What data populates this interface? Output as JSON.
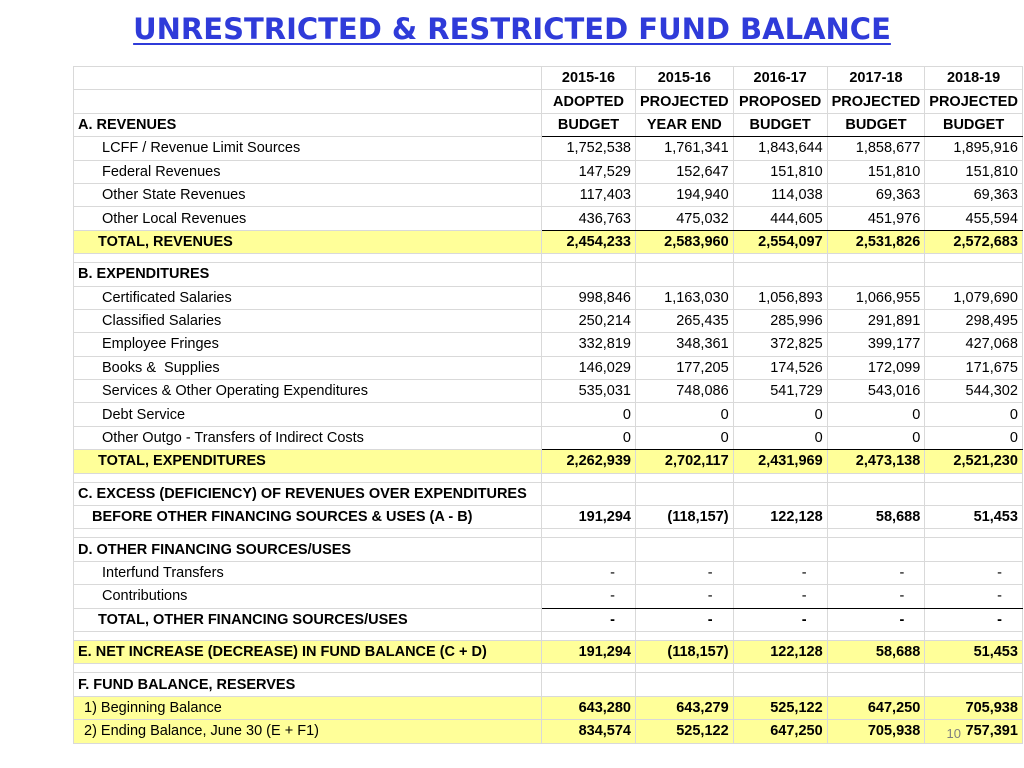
{
  "title": "UNRESTRICTED & RESTRICTED FUND BALANCE",
  "page_number": "10",
  "headers": {
    "row1": [
      "2015-16",
      "2015-16",
      "2016-17",
      "2017-18",
      "2018-19"
    ],
    "row2": [
      "ADOPTED",
      "PROJECTED",
      "PROPOSED",
      "PROJECTED",
      "PROJECTED"
    ],
    "row3": [
      "BUDGET",
      "YEAR END",
      "BUDGET",
      "BUDGET",
      "BUDGET"
    ]
  },
  "revenues": {
    "heading": "A. REVENUES",
    "rows": [
      {
        "label": "LCFF / Revenue Limit Sources",
        "values": [
          "1,752,538",
          "1,761,341",
          "1,843,644",
          "1,858,677",
          "1,895,916"
        ]
      },
      {
        "label": "Federal Revenues",
        "values": [
          "147,529",
          "152,647",
          "151,810",
          "151,810",
          "151,810"
        ]
      },
      {
        "label": "Other State Revenues",
        "values": [
          "117,403",
          "194,940",
          "114,038",
          "69,363",
          "69,363"
        ]
      },
      {
        "label": "Other Local Revenues",
        "values": [
          "436,763",
          "475,032",
          "444,605",
          "451,976",
          "455,594"
        ]
      }
    ],
    "total": {
      "label": "TOTAL, REVENUES",
      "values": [
        "2,454,233",
        "2,583,960",
        "2,554,097",
        "2,531,826",
        "2,572,683"
      ]
    }
  },
  "expenditures": {
    "heading": "B. EXPENDITURES",
    "rows": [
      {
        "label": "Certificated Salaries",
        "values": [
          "998,846",
          "1,163,030",
          "1,056,893",
          "1,066,955",
          "1,079,690"
        ]
      },
      {
        "label": "Classified Salaries",
        "values": [
          "250,214",
          "265,435",
          "285,996",
          "291,891",
          "298,495"
        ]
      },
      {
        "label": "Employee Fringes",
        "values": [
          "332,819",
          "348,361",
          "372,825",
          "399,177",
          "427,068"
        ]
      },
      {
        "label": "Books &  Supplies",
        "values": [
          "146,029",
          "177,205",
          "174,526",
          "172,099",
          "171,675"
        ]
      },
      {
        "label": "Services & Other Operating Expenditures",
        "values": [
          "535,031",
          "748,086",
          "541,729",
          "543,016",
          "544,302"
        ]
      },
      {
        "label": "Debt Service",
        "values": [
          "0",
          "0",
          "0",
          "0",
          "0"
        ]
      },
      {
        "label": "Other Outgo - Transfers of Indirect Costs",
        "values": [
          "0",
          "0",
          "0",
          "0",
          "0"
        ]
      }
    ],
    "total": {
      "label": "TOTAL, EXPENDITURES",
      "values": [
        "2,262,939",
        "2,702,117",
        "2,431,969",
        "2,473,138",
        "2,521,230"
      ]
    }
  },
  "excess": {
    "heading": "C. EXCESS (DEFICIENCY) OF REVENUES OVER EXPENDITURES",
    "label": "BEFORE OTHER FINANCING SOURCES & USES (A - B)",
    "values": [
      "191,294",
      "(118,157)",
      "122,128",
      "58,688",
      "51,453"
    ]
  },
  "other_financing": {
    "heading": "D. OTHER FINANCING SOURCES/USES",
    "rows": [
      {
        "label": "Interfund Transfers",
        "values": [
          "-",
          "-",
          "-",
          "-",
          "-"
        ]
      },
      {
        "label": "Contributions",
        "values": [
          "-",
          "-",
          "-",
          "-",
          "-"
        ]
      }
    ],
    "total": {
      "label": "TOTAL, OTHER FINANCING SOURCES/USES",
      "values": [
        "-",
        "-",
        "-",
        "-",
        "-"
      ]
    }
  },
  "net_increase": {
    "label": "E. NET INCREASE (DECREASE) IN FUND BALANCE (C + D)",
    "values": [
      "191,294",
      "(118,157)",
      "122,128",
      "58,688",
      "51,453"
    ]
  },
  "fund_balance": {
    "heading": "F. FUND BALANCE, RESERVES",
    "rows": [
      {
        "label": "1) Beginning Balance",
        "values": [
          "643,280",
          "643,279",
          "525,122",
          "647,250",
          "705,938"
        ]
      },
      {
        "label": "2) Ending Balance, June 30 (E + F1)",
        "values": [
          "834,574",
          "525,122",
          "647,250",
          "705,938",
          "757,391"
        ]
      }
    ]
  }
}
